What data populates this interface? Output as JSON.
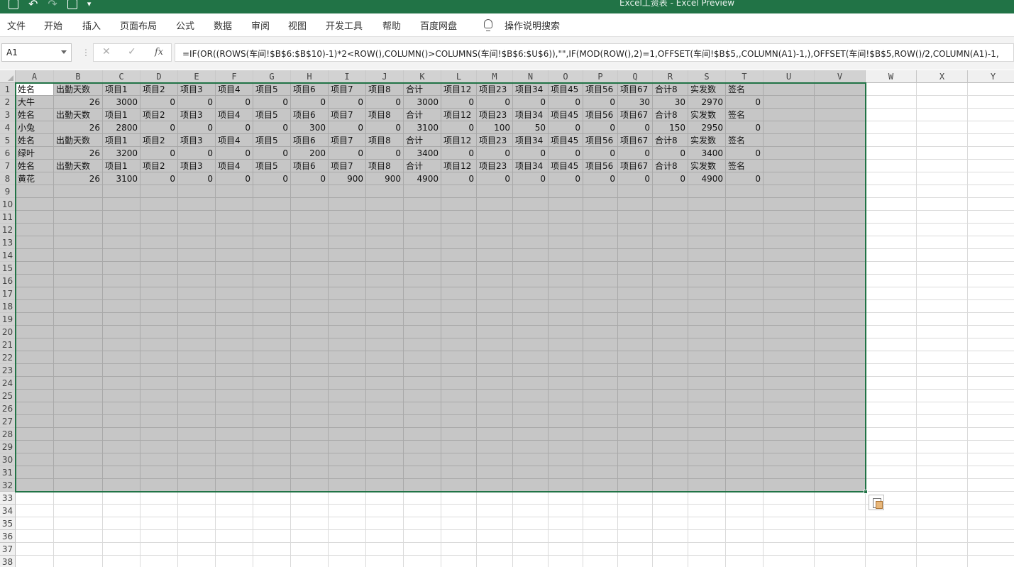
{
  "title_bar": {
    "title": "Excel工资表  -  Excel Preview"
  },
  "quick_access": [
    "save-icon",
    "undo-icon",
    "redo-icon",
    "camera-icon",
    "customize-icon"
  ],
  "menu": {
    "items": [
      "文件",
      "开始",
      "插入",
      "页面布局",
      "公式",
      "数据",
      "审阅",
      "视图",
      "开发工具",
      "帮助",
      "百度网盘"
    ],
    "tell_me": "操作说明搜索"
  },
  "formula_bar": {
    "name_box": "A1",
    "cancel": "✕",
    "enter": "✓",
    "fx": "fx",
    "formula": "=IF(OR((ROWS(车间!$B$6:$B$10)-1)*2<ROW(),COLUMN()>COLUMNS(车间!$B$6:$U$6)),\"\",IF(MOD(ROW(),2)=1,OFFSET(车间!$B$5,,COLUMN(A1)-1,),OFFSET(车间!$B$5,ROW()/2,COLUMN(A1)-1,"
  },
  "columns": [
    "A",
    "B",
    "C",
    "D",
    "E",
    "F",
    "G",
    "H",
    "I",
    "J",
    "K",
    "L",
    "M",
    "N",
    "O",
    "P",
    "Q",
    "R",
    "S",
    "T",
    "U",
    "V",
    "W",
    "X",
    "Y"
  ],
  "row_numbers": [
    "1",
    "2",
    "3",
    "4",
    "5",
    "6",
    "7",
    "8",
    "9",
    "10",
    "11",
    "12",
    "13",
    "14",
    "15",
    "16",
    "17",
    "18",
    "19",
    "20",
    "21",
    "22",
    "23",
    "24",
    "25",
    "26",
    "27",
    "28",
    "29",
    "30",
    "31",
    "32",
    "33",
    "34",
    "35",
    "36",
    "37",
    "38"
  ],
  "selection": "A1:V32",
  "sheet_rows": [
    [
      "姓名",
      "出勤天数",
      "项目1",
      "项目2",
      "项目3",
      "项目4",
      "项目5",
      "项目6",
      "项目7",
      "项目8",
      "合计",
      "项目12",
      "项目23",
      "项目34",
      "项目45",
      "项目56",
      "项目67",
      "合计8",
      "实发数",
      "签名"
    ],
    [
      "大牛",
      "26",
      "3000",
      "0",
      "0",
      "0",
      "0",
      "0",
      "0",
      "0",
      "3000",
      "0",
      "0",
      "0",
      "0",
      "0",
      "30",
      "30",
      "2970",
      "0"
    ],
    [
      "姓名",
      "出勤天数",
      "项目1",
      "项目2",
      "项目3",
      "项目4",
      "项目5",
      "项目6",
      "项目7",
      "项目8",
      "合计",
      "项目12",
      "项目23",
      "项目34",
      "项目45",
      "项目56",
      "项目67",
      "合计8",
      "实发数",
      "签名"
    ],
    [
      "小兔",
      "26",
      "2800",
      "0",
      "0",
      "0",
      "0",
      "300",
      "0",
      "0",
      "3100",
      "0",
      "100",
      "50",
      "0",
      "0",
      "0",
      "150",
      "2950",
      "0"
    ],
    [
      "姓名",
      "出勤天数",
      "项目1",
      "项目2",
      "项目3",
      "项目4",
      "项目5",
      "项目6",
      "项目7",
      "项目8",
      "合计",
      "项目12",
      "项目23",
      "项目34",
      "项目45",
      "项目56",
      "项目67",
      "合计8",
      "实发数",
      "签名"
    ],
    [
      "绿叶",
      "26",
      "3200",
      "0",
      "0",
      "0",
      "0",
      "200",
      "0",
      "0",
      "3400",
      "0",
      "0",
      "0",
      "0",
      "0",
      "0",
      "0",
      "3400",
      "0"
    ],
    [
      "姓名",
      "出勤天数",
      "项目1",
      "项目2",
      "项目3",
      "项目4",
      "项目5",
      "项目6",
      "项目7",
      "项目8",
      "合计",
      "项目12",
      "项目23",
      "项目34",
      "项目45",
      "项目56",
      "项目67",
      "合计8",
      "实发数",
      "签名"
    ],
    [
      "黄花",
      "26",
      "3100",
      "0",
      "0",
      "0",
      "0",
      "0",
      "900",
      "900",
      "4900",
      "0",
      "0",
      "0",
      "0",
      "0",
      "0",
      "0",
      "4900",
      "0"
    ]
  ]
}
